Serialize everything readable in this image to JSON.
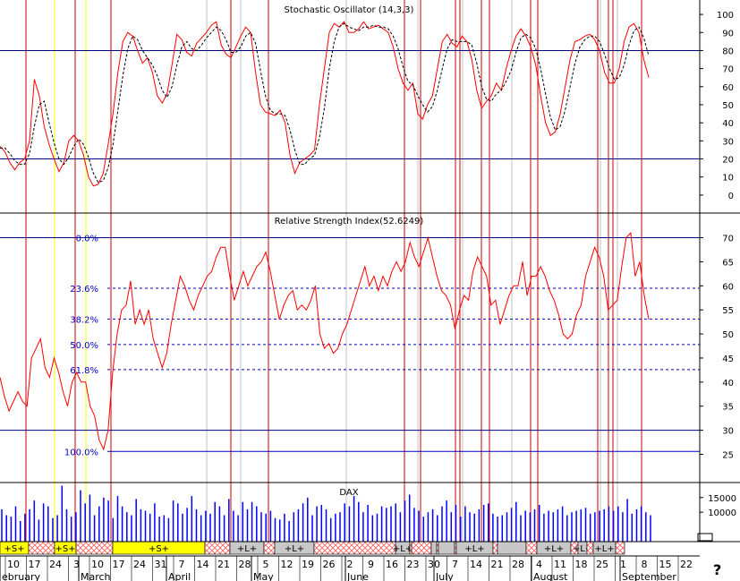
{
  "chart_data": [
    {
      "type": "line",
      "title": "Stochastic Oscillator (14,3,3)",
      "yticks": [
        100,
        90,
        80,
        70,
        60,
        50,
        40,
        30,
        20,
        10,
        0
      ],
      "ylim": [
        -5,
        105
      ],
      "ref_lines": [
        80,
        20
      ],
      "series": [
        {
          "name": "%K",
          "color": "#ff0000",
          "values": [
            27,
            24,
            18,
            14,
            18,
            20,
            30,
            64,
            55,
            38,
            28,
            20,
            13,
            18,
            30,
            33,
            30,
            22,
            10,
            5,
            6,
            12,
            28,
            45,
            68,
            85,
            90,
            88,
            80,
            73,
            76,
            68,
            55,
            51,
            56,
            72,
            89,
            86,
            79,
            77,
            84,
            87,
            90,
            94,
            96,
            83,
            78,
            76,
            82,
            88,
            93,
            90,
            68,
            50,
            46,
            45,
            44,
            47,
            40,
            22,
            12,
            18,
            20,
            22,
            25,
            50,
            70,
            90,
            95,
            93,
            96,
            90,
            90,
            92,
            96,
            92,
            93,
            94,
            92,
            90,
            82,
            70,
            62,
            58,
            62,
            45,
            42,
            50,
            55,
            70,
            85,
            89,
            84,
            82,
            88,
            85,
            75,
            58,
            48,
            52,
            55,
            62,
            58,
            70,
            80,
            88,
            92,
            88,
            82,
            72,
            55,
            40,
            33,
            35,
            45,
            60,
            75,
            85,
            86,
            88,
            89,
            86,
            80,
            68,
            62,
            62,
            70,
            85,
            93,
            95,
            90,
            75,
            65
          ]
        },
        {
          "name": "%D",
          "color": "#000000",
          "dash": true,
          "values": [
            26,
            26,
            23,
            19,
            17,
            17,
            23,
            38,
            50,
            52,
            40,
            29,
            20,
            17,
            21,
            27,
            31,
            28,
            21,
            12,
            7,
            8,
            15,
            28,
            47,
            66,
            81,
            88,
            86,
            80,
            76,
            72,
            66,
            58,
            54,
            60,
            72,
            82,
            85,
            81,
            80,
            83,
            87,
            90,
            93,
            91,
            86,
            79,
            79,
            82,
            88,
            90,
            84,
            69,
            55,
            47,
            45,
            45,
            44,
            36,
            25,
            17,
            17,
            20,
            22,
            32,
            48,
            70,
            85,
            93,
            95,
            93,
            92,
            91,
            93,
            93,
            94,
            93,
            93,
            92,
            88,
            81,
            71,
            63,
            61,
            55,
            50,
            46,
            49,
            58,
            70,
            81,
            86,
            85,
            85,
            85,
            83,
            73,
            60,
            53,
            52,
            56,
            58,
            63,
            69,
            79,
            87,
            89,
            87,
            81,
            70,
            56,
            43,
            36,
            38,
            47,
            60,
            73,
            82,
            86,
            88,
            88,
            85,
            78,
            70,
            64,
            65,
            72,
            83,
            91,
            93,
            87,
            77
          ]
        }
      ]
    },
    {
      "type": "line",
      "title": "Relative Strength Index(52.6249)",
      "yticks": [
        70,
        65,
        60,
        55,
        50,
        45,
        40,
        35,
        30,
        25
      ],
      "ylim": [
        21,
        74
      ],
      "ref_lines": [
        70,
        30
      ],
      "fibonacci": [
        {
          "label": "0.0%",
          "value": 70
        },
        {
          "label": "23.6%",
          "value": 59.5
        },
        {
          "label": "38.2%",
          "value": 53.1
        },
        {
          "label": "50.0%",
          "value": 47.8
        },
        {
          "label": "61.8%",
          "value": 42.6
        },
        {
          "label": "100.0%",
          "value": 25.6
        }
      ],
      "series": [
        {
          "name": "RSI",
          "color": "#ff0000",
          "values": [
            41,
            37,
            34,
            36,
            38,
            36,
            35,
            45,
            47,
            49,
            43,
            41,
            45,
            42,
            38,
            35,
            40,
            42,
            40,
            40,
            35,
            33,
            28,
            26,
            30,
            42,
            50,
            55,
            56,
            61,
            52,
            55,
            52,
            55,
            49,
            46,
            43,
            46,
            52,
            57,
            62,
            60,
            57,
            55,
            58,
            60,
            62,
            63,
            66,
            68,
            68,
            62,
            57,
            60,
            63,
            60,
            62,
            64,
            65,
            67,
            63,
            58,
            53,
            56,
            58,
            59,
            55,
            56,
            55,
            57,
            60,
            50,
            47,
            48,
            46,
            47,
            50,
            52,
            55,
            58,
            61,
            64,
            60,
            62,
            59,
            62,
            60,
            63,
            65,
            63,
            65,
            69,
            66,
            64,
            67,
            70,
            66,
            62,
            59,
            58,
            56,
            51,
            55,
            58,
            57,
            63,
            66,
            64,
            62,
            56,
            57,
            52,
            55,
            58,
            60,
            60,
            65,
            58,
            62,
            62,
            64,
            62,
            59,
            57,
            54,
            50,
            49,
            50,
            54,
            56,
            62,
            65,
            68,
            66,
            62,
            55,
            56,
            57,
            64,
            70,
            71,
            62,
            65,
            58,
            53
          ]
        }
      ]
    },
    {
      "type": "bar",
      "title": "DAX",
      "yticks": [
        15000,
        10000
      ],
      "ylim": [
        0,
        19500
      ],
      "color": "#0000ff",
      "values": [
        11000,
        9000,
        8500,
        12000,
        7000,
        9500,
        11000,
        14000,
        7500,
        13000,
        12000,
        8000,
        9000,
        19000,
        11000,
        8500,
        10000,
        17500,
        13000,
        16000,
        9000,
        12000,
        15000,
        14000,
        8000,
        15500,
        12000,
        10000,
        9000,
        14500,
        11000,
        10500,
        9500,
        13000,
        8500,
        9000,
        8000,
        14000,
        13000,
        9500,
        11500,
        15500,
        11000,
        9000,
        10500,
        9500,
        13500,
        12000,
        9000,
        14500,
        10500,
        9000,
        13500,
        11000,
        13500,
        12000,
        10000,
        9500,
        10500,
        8000,
        7500,
        9500,
        7000,
        10000,
        11000,
        13000,
        15000,
        9000,
        12000,
        12500,
        11000,
        8000,
        9500,
        10000,
        13000,
        12000,
        15500,
        13500,
        10000,
        12500,
        9000,
        9500,
        12000,
        11500,
        12000,
        13000,
        10000,
        14000,
        16000,
        11500,
        10500,
        8500,
        10000,
        11000,
        9000,
        12000,
        14000,
        10000,
        12500,
        8500,
        12000,
        10000,
        9500,
        11000,
        12500,
        13000,
        9500,
        8500,
        9000,
        10000,
        11500,
        13500,
        9000,
        10500,
        10000,
        11000,
        12500,
        9500,
        10500,
        10000,
        11000,
        12000,
        9000,
        10000,
        10500,
        11000,
        11500,
        9500,
        10000,
        10500,
        11000,
        12000,
        10500,
        12000,
        10000,
        14500,
        9500,
        11000,
        12000,
        10000,
        9000
      ]
    }
  ],
  "signals": [
    {
      "label": "+S+",
      "type": "s"
    },
    {
      "label": "",
      "type": "h"
    },
    {
      "label": "+S+",
      "type": "s"
    },
    {
      "label": "",
      "type": "h"
    },
    {
      "label": "+S+",
      "type": "s"
    },
    {
      "label": "",
      "type": "h"
    },
    {
      "label": "+L+",
      "type": "l"
    },
    {
      "label": "",
      "type": "h"
    },
    {
      "label": "+L+",
      "type": "l"
    },
    {
      "label": "",
      "type": "h"
    },
    {
      "label": "+L+",
      "type": "l"
    },
    {
      "label": "",
      "type": "h"
    },
    {
      "label": "",
      "type": "h"
    },
    {
      "label": "",
      "type": "l"
    },
    {
      "label": "",
      "type": "h"
    },
    {
      "label": "",
      "type": "l"
    },
    {
      "label": "",
      "type": "h"
    },
    {
      "label": "+L+",
      "type": "l"
    },
    {
      "label": "",
      "type": "h"
    },
    {
      "label": "",
      "type": "l"
    },
    {
      "label": "",
      "type": "h"
    },
    {
      "label": "+L+",
      "type": "l"
    },
    {
      "label": "",
      "type": "h"
    },
    {
      "label": "+L+",
      "type": "l"
    },
    {
      "label": "",
      "type": "h"
    },
    {
      "label": "+L+",
      "type": "l"
    },
    {
      "label": "",
      "type": "h"
    }
  ],
  "x_axis": {
    "days": [
      "10",
      "17",
      "24",
      "3",
      "10",
      "17",
      "24",
      "31",
      "7",
      "14",
      "21",
      "28",
      "5",
      "12",
      "19",
      "26",
      "2",
      "9",
      "16",
      "23",
      "30",
      "7",
      "14",
      "21",
      "28",
      "4",
      "11",
      "18",
      "25",
      "1",
      "8",
      "15",
      "22"
    ],
    "months": [
      "ebruary",
      "March",
      "April",
      "May",
      "June",
      "July",
      "August",
      "September"
    ]
  },
  "lines": {
    "red": [
      [
        29,
        1
      ],
      [
        84,
        1
      ],
      [
        124,
        1
      ],
      [
        258,
        1
      ],
      [
        300,
        1
      ],
      [
        452,
        1
      ],
      [
        470,
        1
      ],
      [
        509,
        1
      ],
      [
        514,
        1
      ],
      [
        538,
        1
      ],
      [
        547,
        1
      ],
      [
        593,
        1
      ],
      [
        601,
        1
      ],
      [
        668,
        1
      ],
      [
        680,
        1
      ],
      [
        685,
        1
      ],
      [
        717,
        1
      ]
    ],
    "yellow": [
      61,
      96
    ],
    "gray": [
      231,
      269,
      387,
      467,
      517,
      572,
      671,
      690
    ]
  },
  "footer": {
    "corner_mark": "?"
  }
}
